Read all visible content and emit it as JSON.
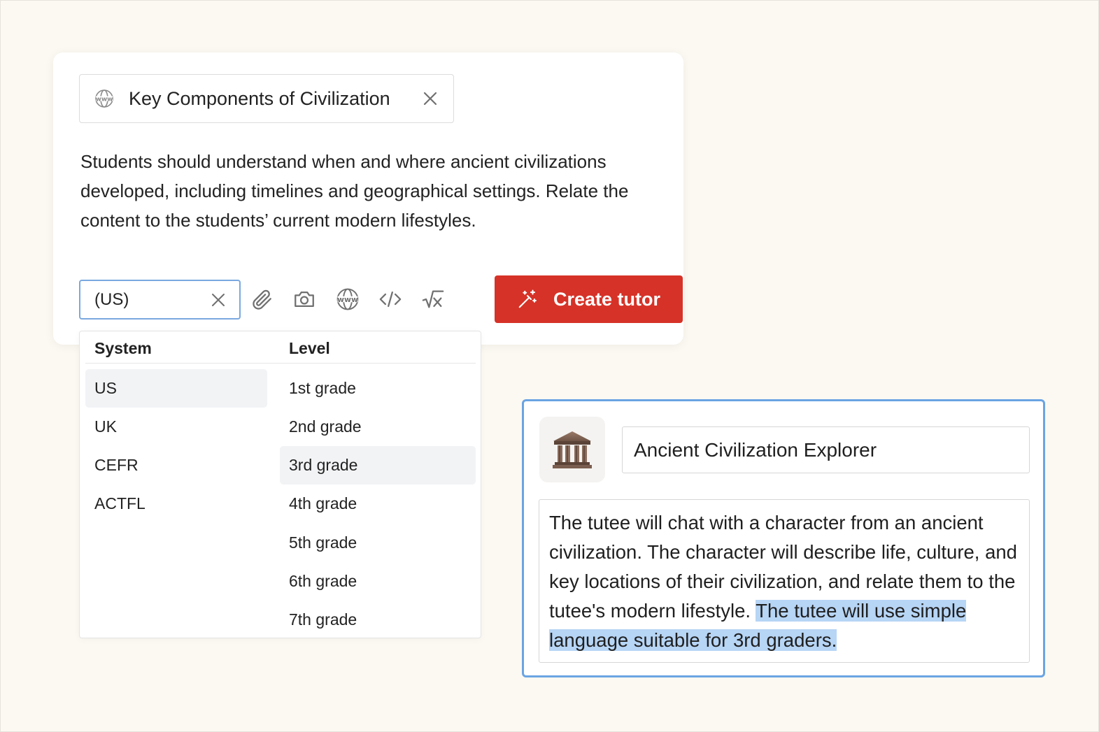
{
  "source_chip": {
    "icon": "www-globe-icon",
    "title": "Key Components of Civilization"
  },
  "prompt": {
    "text": "Students should understand when and where ancient civilizations developed, including timelines and geographical settings. Relate the content to the students’ current modern lifestyles."
  },
  "toolbar": {
    "level_value": "(US)",
    "tools": [
      "paperclip-icon",
      "camera-icon",
      "www-globe-icon",
      "code-icon",
      "math-sqrt-icon"
    ],
    "create_label": "Create tutor"
  },
  "dropdown": {
    "system_header": "System",
    "level_header": "Level",
    "systems": [
      "US",
      "UK",
      "CEFR",
      "ACTFL"
    ],
    "selected_system": "US",
    "levels": [
      "1st grade",
      "2nd grade",
      "3rd grade",
      "4th grade",
      "5th grade",
      "6th grade",
      "7th grade"
    ],
    "highlighted_level": "3rd grade"
  },
  "result": {
    "avatar_icon": "classical-building-icon",
    "name": "Ancient Civilization Explorer",
    "description_plain": "The tutee will chat with a character from an ancient civilization. The character will describe life, culture, and key locations of their civilization, and relate them to the tutee's modern lifestyle. ",
    "description_highlighted": "The tutee will use simple language suitable for 3rd graders."
  },
  "colors": {
    "background": "#fcf9f2",
    "accent_red": "#d63227",
    "focus_blue": "#6aa4e3",
    "highlight": "#b7d5f5"
  }
}
